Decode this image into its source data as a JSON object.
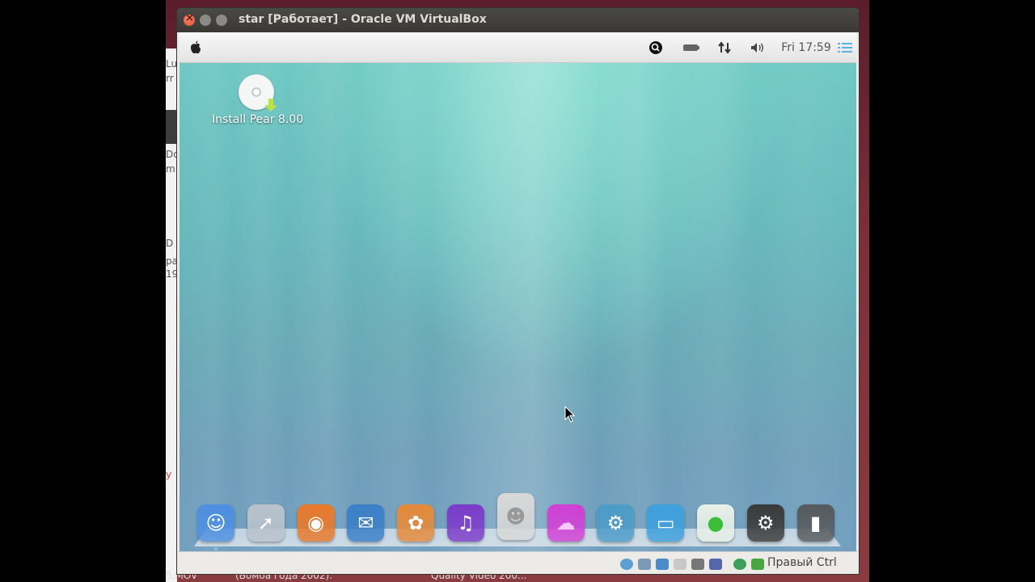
{
  "window": {
    "title": "star [Работает] - Oracle VM VirtualBox"
  },
  "guest_topbar": {
    "clock": "Fri 17:59",
    "icons": [
      "apple-icon",
      "search-icon",
      "battery-icon",
      "network-icon",
      "volume-icon",
      "menu-list-icon"
    ]
  },
  "desktop": {
    "icon_label": "Install Pear 8.00"
  },
  "dock": {
    "items": [
      {
        "name": "finder",
        "color": "#4d8fe0",
        "glyph": "☺"
      },
      {
        "name": "launchpad",
        "color": "#b9c2cc",
        "glyph": "➚"
      },
      {
        "name": "firefox",
        "color": "#e8792a",
        "glyph": "◉"
      },
      {
        "name": "thunderbird",
        "color": "#3a7fc8",
        "glyph": "✉"
      },
      {
        "name": "photos",
        "color": "#e58a3a",
        "glyph": "✿"
      },
      {
        "name": "itunes",
        "color": "#7b3cc9",
        "glyph": "♫"
      },
      {
        "name": "contacts",
        "color": "#d8d8d8",
        "glyph": "☻"
      },
      {
        "name": "icloud",
        "color": "#d23fd6",
        "glyph": "☁"
      },
      {
        "name": "settings",
        "color": "#4c9cc8",
        "glyph": "⚙"
      },
      {
        "name": "display",
        "color": "#3ea0dc",
        "glyph": "▭"
      },
      {
        "name": "toggle",
        "color": "#e8f0e8",
        "glyph": "●"
      },
      {
        "name": "terminal",
        "color": "#3a3a3a",
        "glyph": "⚙"
      },
      {
        "name": "trash",
        "color": "#555a5e",
        "glyph": "▮"
      }
    ]
  },
  "statusbar": {
    "host_key": "Правый Ctrl"
  },
  "host": {
    "left_fragments": [
      "Lu",
      "rr",
      "Do",
      "m",
      "D",
      "pa",
      "19",
      "y"
    ],
    "bottom_fragments": [
      "5.MOV",
      "(Бомба года 2002).",
      "Quality Video 200..."
    ]
  }
}
